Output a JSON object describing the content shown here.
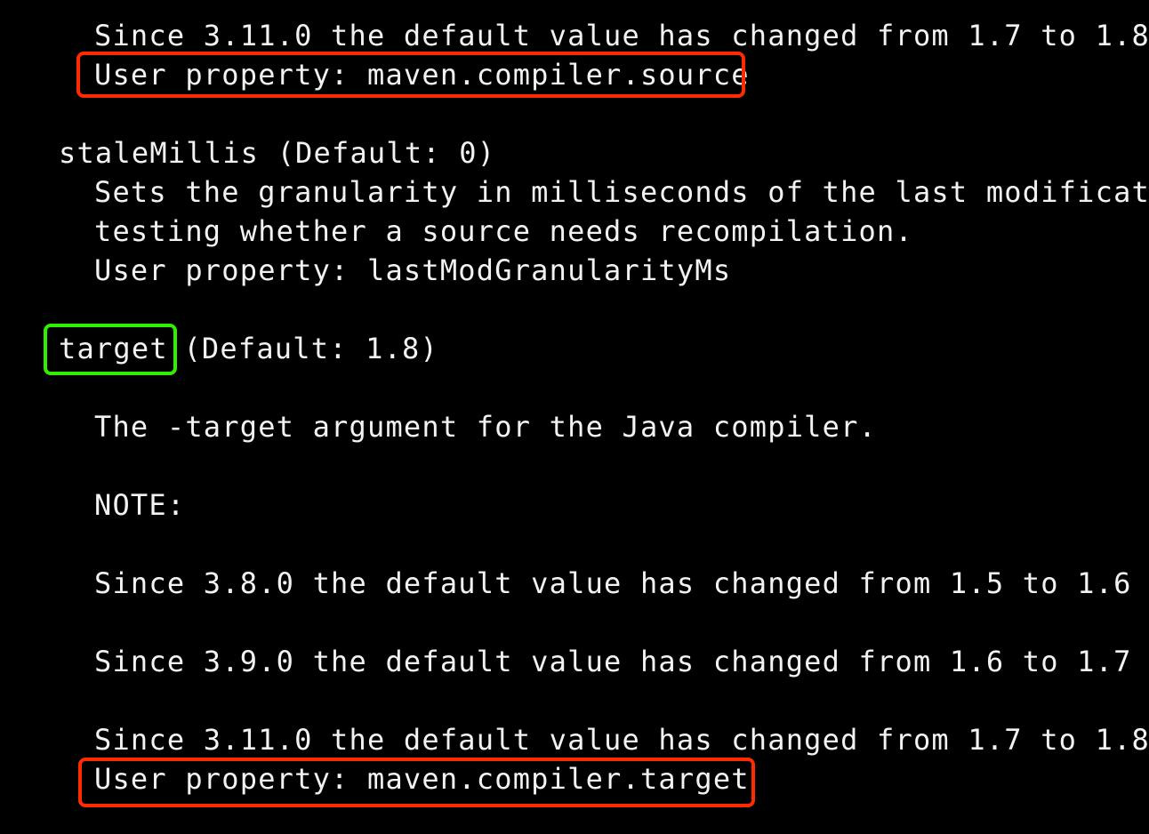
{
  "terminal": {
    "lines": [
      "Since 3.11.0 the default value has changed from 1.7 to 1.8",
      "User property: maven.compiler.source",
      "staleMillis (Default: 0)",
      "Sets the granularity in milliseconds of the last modificatio",
      "testing whether a source needs recompilation.",
      "User property: lastModGranularityMs",
      "target",
      " (Default: 1.8)",
      "The -target argument for the Java compiler.",
      "NOTE:",
      "Since 3.8.0 the default value has changed from 1.5 to 1.6",
      "Since 3.9.0 the default value has changed from 1.6 to 1.7",
      "Since 3.11.0 the default value has changed from 1.7 to 1.8",
      "User property: maven.compiler.target"
    ],
    "highlight_colors": {
      "red": "#ff2a00",
      "green": "#2ff000"
    }
  }
}
